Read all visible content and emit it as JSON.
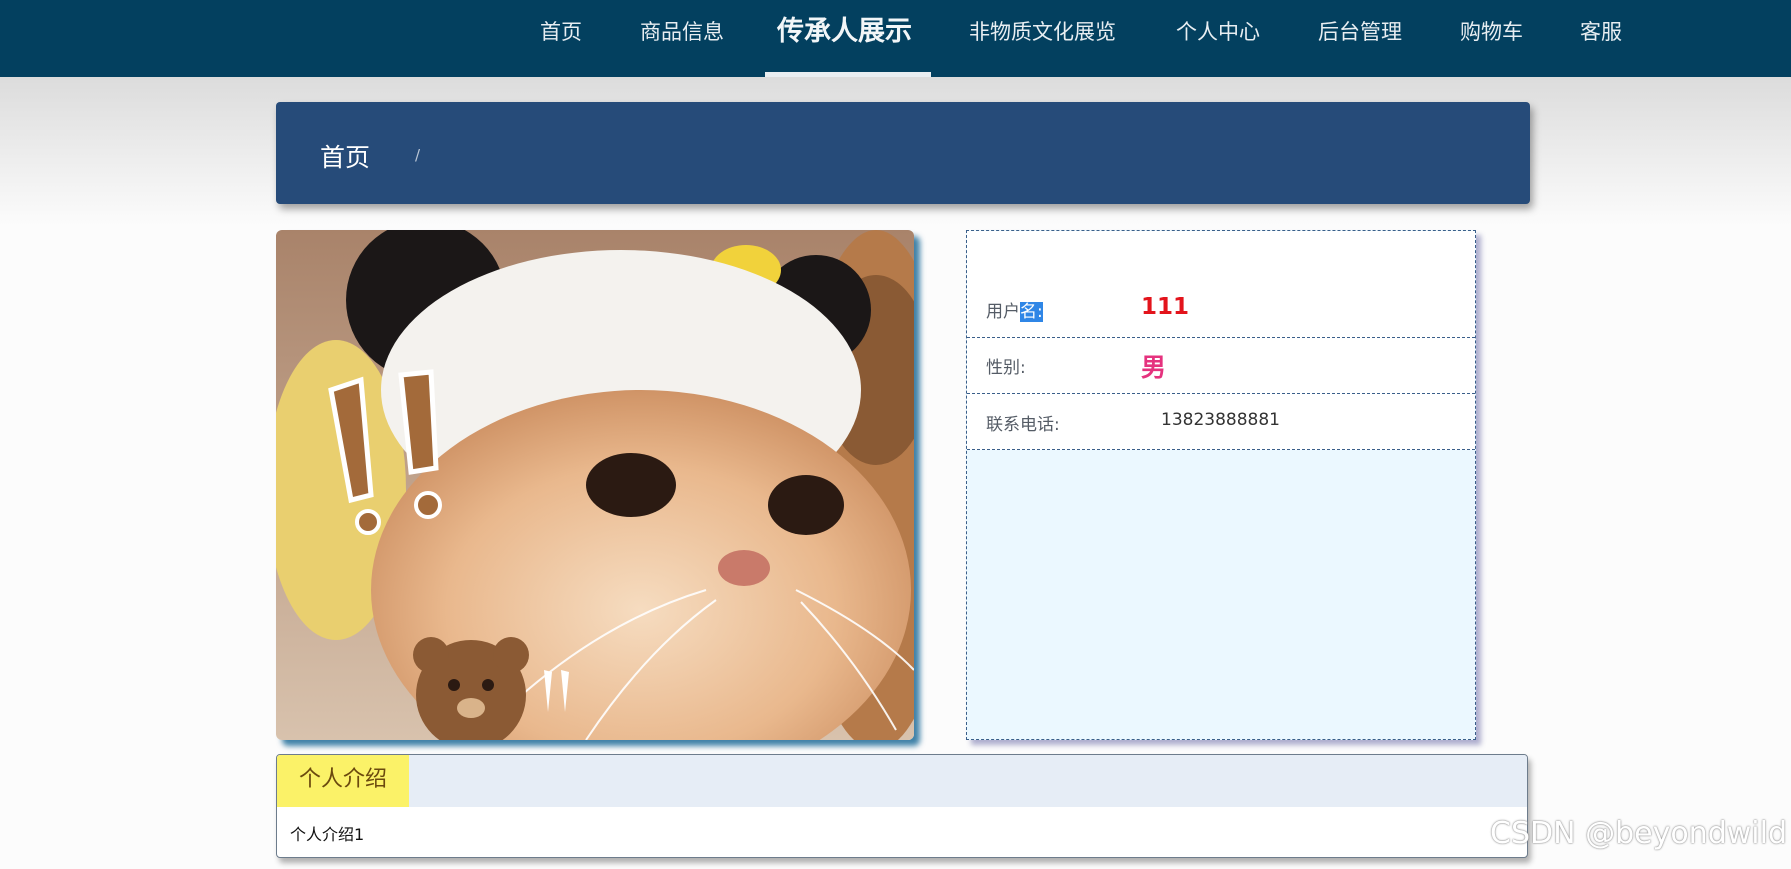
{
  "nav": {
    "items": [
      {
        "label": "首页"
      },
      {
        "label": "商品信息"
      },
      {
        "label": "传承人展示",
        "active": true
      },
      {
        "label": "非物质文化展览"
      },
      {
        "label": "个人中心"
      },
      {
        "label": "后台管理"
      },
      {
        "label": "购物车"
      },
      {
        "label": "客服"
      }
    ]
  },
  "breadcrumb": {
    "home": "首页",
    "separator": "/"
  },
  "profile": {
    "username_label_a": "用户",
    "username_label_b": "名:",
    "username": "111",
    "gender_label": "性别:",
    "gender": "男",
    "phone_label": "联系电话:",
    "phone": "13823888881"
  },
  "intro": {
    "tab_label": "个人介绍",
    "text": "个人介绍1"
  },
  "watermark": "CSDN @beyondwild",
  "colors": {
    "nav_bg": "#03405f",
    "breadcrumb_bg": "#264b79",
    "username": "#e3141c",
    "gender": "#e5327e",
    "intro_tab": "#fbf268"
  }
}
